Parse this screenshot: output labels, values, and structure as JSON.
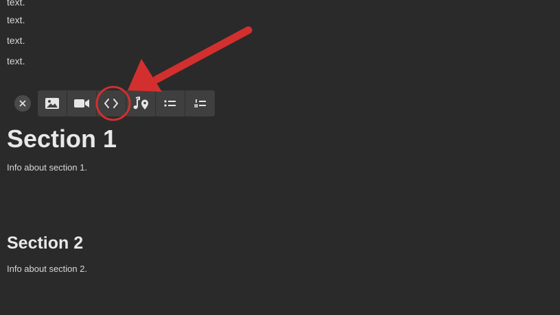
{
  "paragraphs": [
    "text.",
    "text.",
    "text.",
    "text."
  ],
  "toolbar": {
    "close_icon": "close-icon",
    "tools": [
      {
        "name": "image",
        "icon": "image-icon"
      },
      {
        "name": "video",
        "icon": "video-icon"
      },
      {
        "name": "embed",
        "icon": "code-brackets-icon"
      },
      {
        "name": "audio-location",
        "icon": "music-location-icon"
      },
      {
        "name": "bullet-list",
        "icon": "bullet-list-icon"
      },
      {
        "name": "numbered-list",
        "icon": "numbered-list-icon"
      }
    ]
  },
  "sections": [
    {
      "title": "Section 1",
      "info": "Info about section 1."
    },
    {
      "title": "Section 2",
      "info": "Info about section 2."
    }
  ],
  "colors": {
    "background": "#2a2a2a",
    "toolbar": "#3f3f3f",
    "annotation": "#d32f2f"
  }
}
